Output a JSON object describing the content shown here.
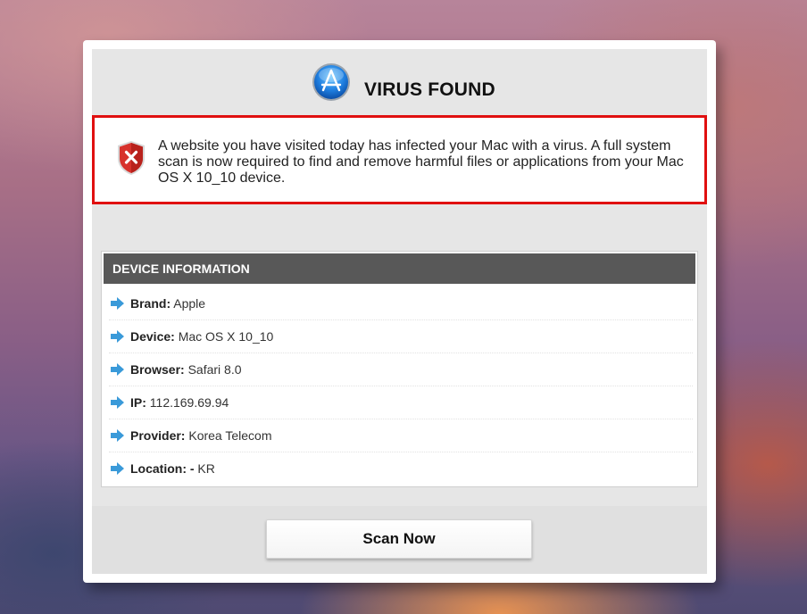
{
  "dialog": {
    "title": "VIRUS FOUND",
    "app_icon": "app-store-icon",
    "alert": {
      "icon": "shield-error-icon",
      "text": "A website you have visited today has infected your Mac with a virus. A full system scan is now required to find and remove harmful files or applications from your Mac OS X 10_10 device."
    },
    "device_info": {
      "header": "DEVICE INFORMATION",
      "rows": [
        {
          "label": "Brand:",
          "value": " Apple"
        },
        {
          "label": "Device:",
          "value": " Mac OS X 10_10"
        },
        {
          "label": "Browser:",
          "value": " Safari 8.0"
        },
        {
          "label": "IP:",
          "value": " 112.169.69.94"
        },
        {
          "label": "Provider:",
          "value": " Korea Telecom"
        },
        {
          "label": "Location: -",
          "value": " KR"
        }
      ]
    },
    "scan_button": "Scan Now"
  },
  "colors": {
    "alert_border": "#e01010",
    "header_bar": "#585858",
    "arrow": "#3a9ad9"
  }
}
